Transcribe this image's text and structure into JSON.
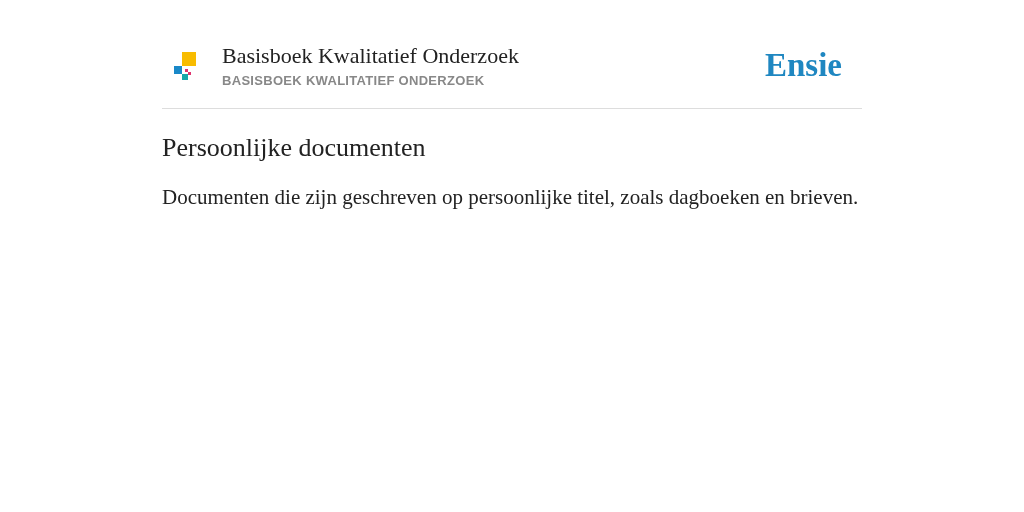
{
  "header": {
    "title": "Basisboek Kwalitatief Onderzoek",
    "subtitle": "BASISBOEK KWALITATIEF ONDERZOEK",
    "brand": "Ensie"
  },
  "entry": {
    "heading": "Persoonlijke documenten",
    "definition": "Documenten die zijn geschreven op persoonlijke titel, zoals dagboeken en brieven."
  }
}
